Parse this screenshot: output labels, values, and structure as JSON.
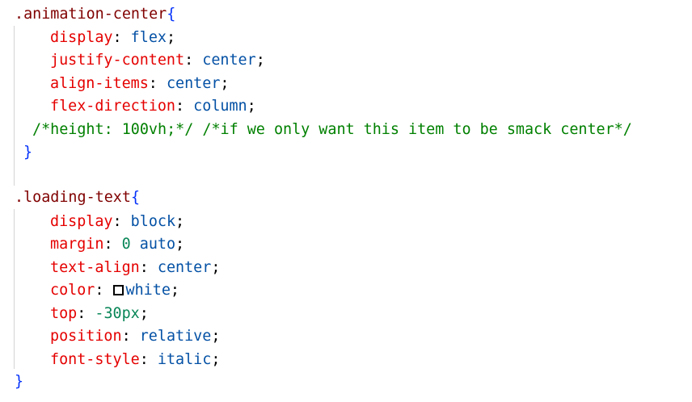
{
  "rule1": {
    "selector": ".animation-center",
    "open_brace": "{",
    "close_brace": "}",
    "declarations": [
      {
        "property": "display",
        "colon": ": ",
        "value": "flex",
        "semicolon": ";"
      },
      {
        "property": "justify-content",
        "colon": ": ",
        "value": "center",
        "semicolon": ";"
      },
      {
        "property": "align-items",
        "colon": ": ",
        "value": "center",
        "semicolon": ";"
      },
      {
        "property": "flex-direction",
        "colon": ": ",
        "value": "column",
        "semicolon": ";"
      }
    ],
    "comment": "/*height: 100vh;*/ /*if we only want this item to be smack center*/"
  },
  "rule2": {
    "selector": ".loading-text",
    "open_brace": "{",
    "close_brace": "}",
    "declarations": [
      {
        "property": "display",
        "colon": ": ",
        "value": "block",
        "semicolon": ";"
      },
      {
        "property": "margin",
        "colon": ": ",
        "value_number": "0",
        "value": " auto",
        "semicolon": ";"
      },
      {
        "property": "text-align",
        "colon": ": ",
        "value": "center",
        "semicolon": ";"
      },
      {
        "property": "color",
        "colon": ": ",
        "value": "white",
        "semicolon": ";",
        "swatch_color": "#ffffff"
      },
      {
        "property": "top",
        "colon": ": ",
        "value_number": "-30px",
        "semicolon": ";"
      },
      {
        "property": "position",
        "colon": ": ",
        "value": "relative",
        "semicolon": ";"
      },
      {
        "property": "font-style",
        "colon": ": ",
        "value": "italic",
        "semicolon": ";"
      }
    ]
  },
  "colors": {
    "selector": "#800000",
    "brace": "#0431fa",
    "property": "#e50000",
    "value": "#0451a5",
    "number": "#098658",
    "comment": "#008000",
    "background": "#ffffff"
  }
}
